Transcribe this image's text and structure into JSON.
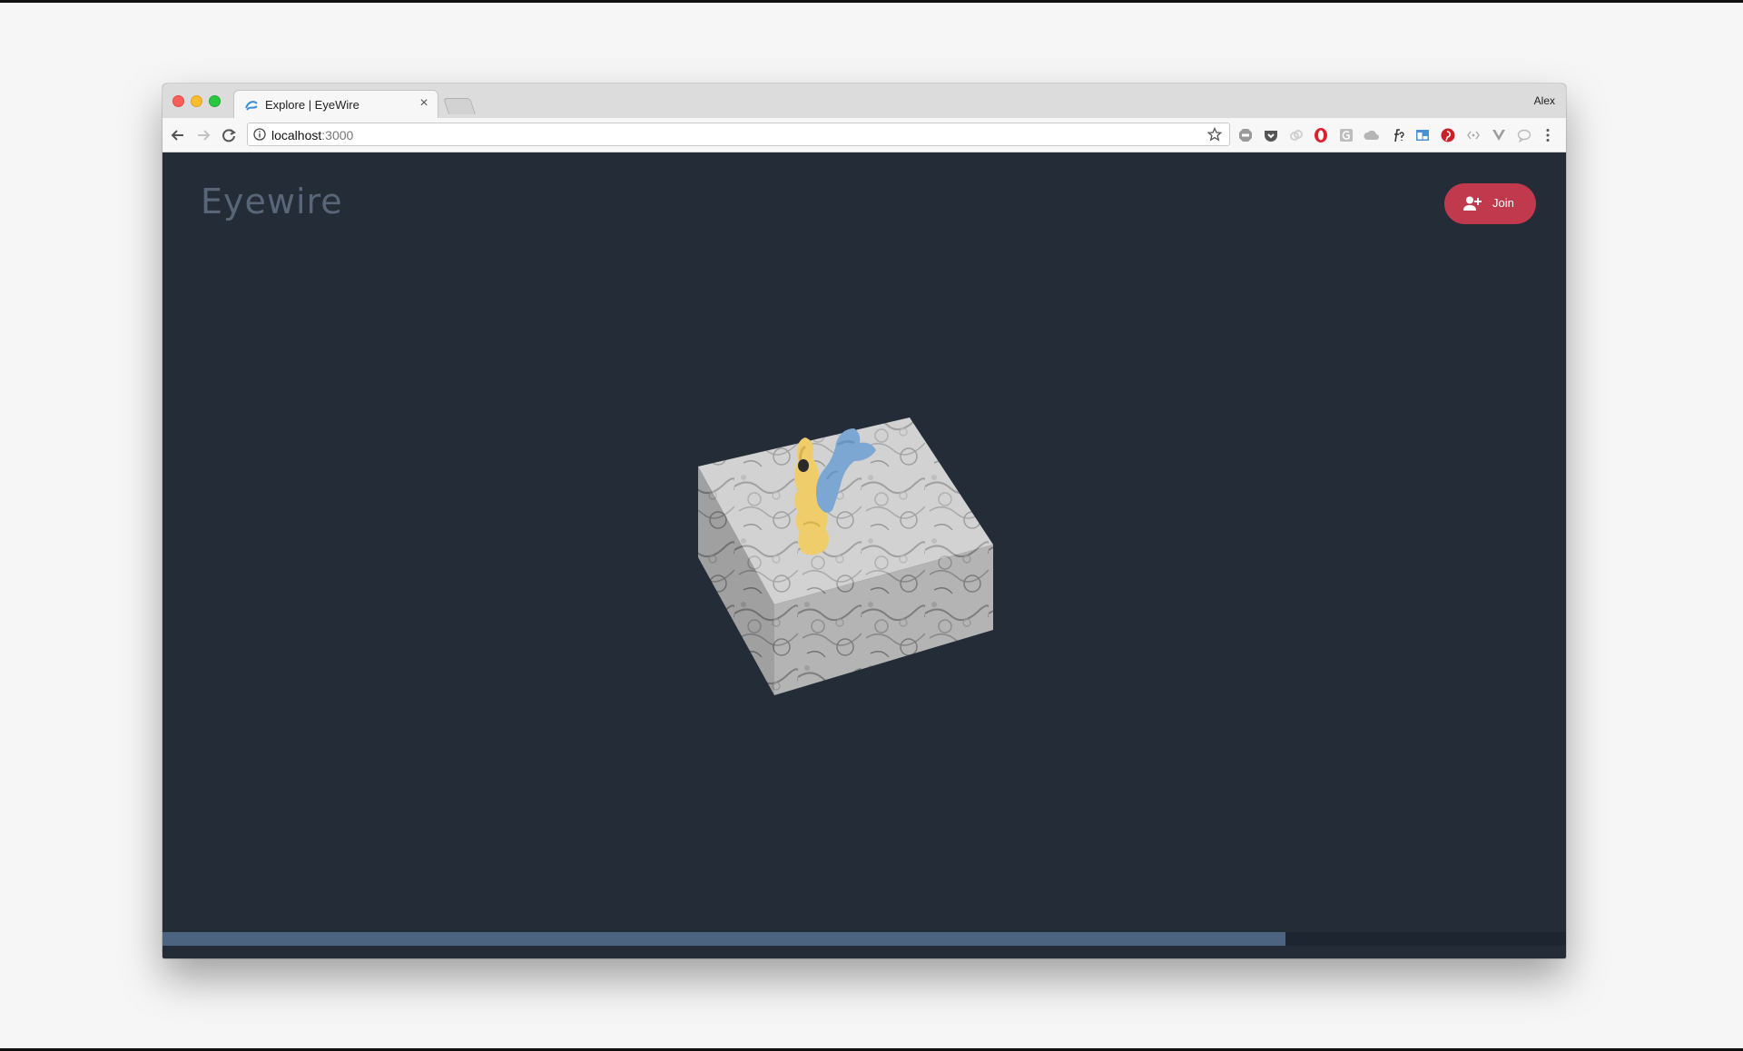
{
  "browser": {
    "tab_title": "Explore | EyeWire",
    "tab_close_label": "×",
    "profile_name": "Alex",
    "url_host": "localhost",
    "url_port": ":3000"
  },
  "extensions": [
    "abp-icon",
    "pocket-icon",
    "link-icon",
    "opera-icon",
    "grammarly-icon",
    "cloud-icon",
    "font-finder-icon",
    "layout-icon",
    "pinterest-icon",
    "code-icon",
    "vue-icon",
    "chat-icon",
    "menu-icon"
  ],
  "app": {
    "logo": "Eyewire",
    "join_label": "Join",
    "accent_color": "#c0394d",
    "background_color": "#232c37"
  },
  "progress": {
    "value": 0.8
  }
}
